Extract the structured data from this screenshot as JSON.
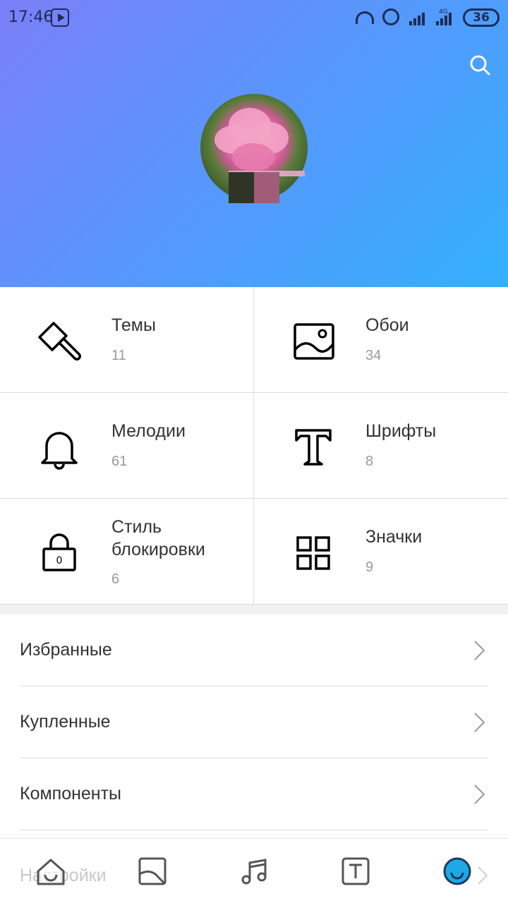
{
  "status_bar": {
    "time": "17:46",
    "network": "4G",
    "battery": "36"
  },
  "header": {
    "gradient_start": "#7b7ff8",
    "gradient_end": "#33b0fd",
    "search_icon": "search-icon"
  },
  "categories": [
    {
      "title": "Темы",
      "count": "11",
      "icon": "brush-icon"
    },
    {
      "title": "Обои",
      "count": "34",
      "icon": "wallpaper-icon"
    },
    {
      "title": "Мелодии",
      "count": "61",
      "icon": "bell-icon"
    },
    {
      "title": "Шрифты",
      "count": "8",
      "icon": "font-icon"
    },
    {
      "title": "Стиль блокировки",
      "count": "6",
      "icon": "lock-icon"
    },
    {
      "title": "Значки",
      "count": "9",
      "icon": "grid-icon"
    }
  ],
  "menu": [
    {
      "label": "Избранные"
    },
    {
      "label": "Купленные"
    },
    {
      "label": "Компоненты"
    }
  ],
  "bottom_nav": {
    "obscured_item_label": "Настройки",
    "items": [
      {
        "icon": "home-icon"
      },
      {
        "icon": "wallpaper-icon"
      },
      {
        "icon": "music-icon"
      },
      {
        "icon": "font-icon"
      },
      {
        "icon": "profile-icon",
        "active": true,
        "color": "#1fa8e6"
      }
    ]
  }
}
